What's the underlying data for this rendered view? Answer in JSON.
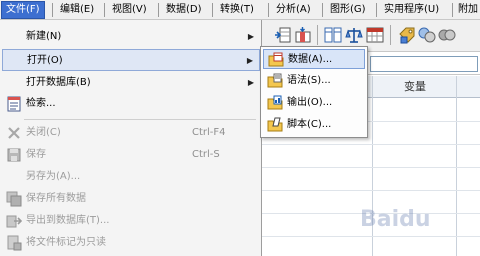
{
  "menubar": {
    "items": [
      {
        "label": "文件(F)"
      },
      {
        "label": "编辑(E)"
      },
      {
        "label": "视图(V)"
      },
      {
        "label": "数据(D)"
      },
      {
        "label": "转换(T)"
      },
      {
        "label": "分析(A)"
      },
      {
        "label": "图形(G)"
      },
      {
        "label": "实用程序(U)"
      },
      {
        "label": "附加"
      }
    ]
  },
  "file_menu": {
    "items": [
      {
        "label": "新建(N)"
      },
      {
        "label": "打开(O)"
      },
      {
        "label": "打开数据库(B)"
      },
      {
        "label": "检索..."
      },
      {
        "label": "关闭(C)",
        "shortcut": "Ctrl-F4"
      },
      {
        "label": "保存",
        "shortcut": "Ctrl-S"
      },
      {
        "label": "另存为(A)..."
      },
      {
        "label": "保存所有数据"
      },
      {
        "label": "导出到数据库(T)..."
      },
      {
        "label": "将文件标记为只读"
      }
    ]
  },
  "open_submenu": {
    "items": [
      {
        "label": "数据(A)..."
      },
      {
        "label": "语法(S)..."
      },
      {
        "label": "输出(O)..."
      },
      {
        "label": "脚本(C)..."
      }
    ]
  },
  "grid": {
    "column_header": "变量"
  },
  "watermark": {
    "text": "Baidu"
  },
  "colors": {
    "accent": "#3d6fd0",
    "menu_bg": "#f4f4f4",
    "hover": "#dfe7f5"
  }
}
